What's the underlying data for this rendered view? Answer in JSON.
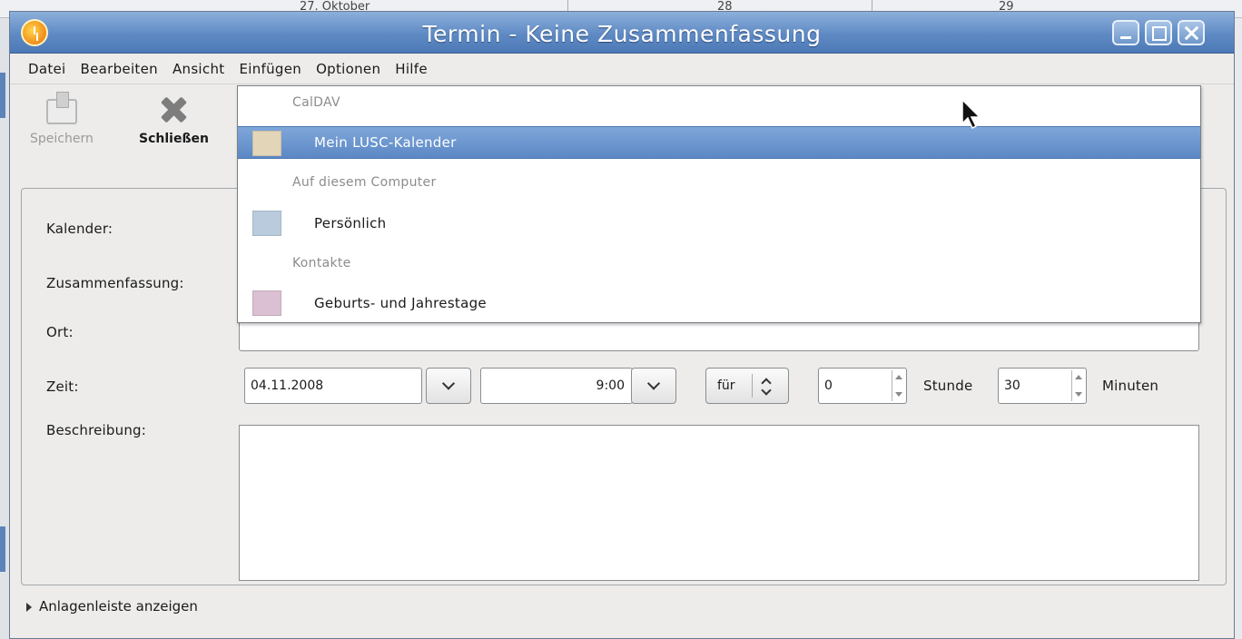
{
  "background": {
    "calendar_header": [
      "27. Oktober",
      "28",
      "29"
    ]
  },
  "window": {
    "title": "Termin - Keine Zusammenfassung",
    "menu": [
      {
        "label": "Datei"
      },
      {
        "label": "Bearbeiten"
      },
      {
        "label": "Ansicht"
      },
      {
        "label": "Einfügen"
      },
      {
        "label": "Optionen"
      },
      {
        "label": "Hilfe"
      }
    ],
    "toolbar": {
      "save_label": "Speichern",
      "close_label": "Schließen"
    }
  },
  "form": {
    "calendar_label": "Kalender:",
    "summary_label": "Zusammenfassung:",
    "location_label": "Ort:",
    "time_label": "Zeit:",
    "description_label": "Beschreibung:",
    "date_value": "04.11.2008",
    "time_value": "9:00",
    "duration_mode": "für",
    "hours_value": "0",
    "hours_unit": "Stunde",
    "minutes_value": "30",
    "minutes_unit": "Minuten",
    "location_value": "",
    "description_value": ""
  },
  "attachments_toggle": "Anlagenleiste anzeigen",
  "calendar_popup": {
    "groups": [
      {
        "header": "CalDAV",
        "items": [
          {
            "label": "Mein LUSC-Kalender",
            "color": "#e3d5b8",
            "selected": true
          }
        ]
      },
      {
        "header": "Auf diesem Computer",
        "items": [
          {
            "label": "Persönlich",
            "color": "#b9cbdc",
            "selected": false
          }
        ]
      },
      {
        "header": "Kontakte",
        "items": [
          {
            "label": "Geburts- und Jahrestage",
            "color": "#dbbfd2",
            "selected": false
          }
        ]
      }
    ]
  },
  "colors": {
    "titlebar": "#5f8ac4",
    "selection": "#6a95cf",
    "window_bg": "#edeceb"
  }
}
